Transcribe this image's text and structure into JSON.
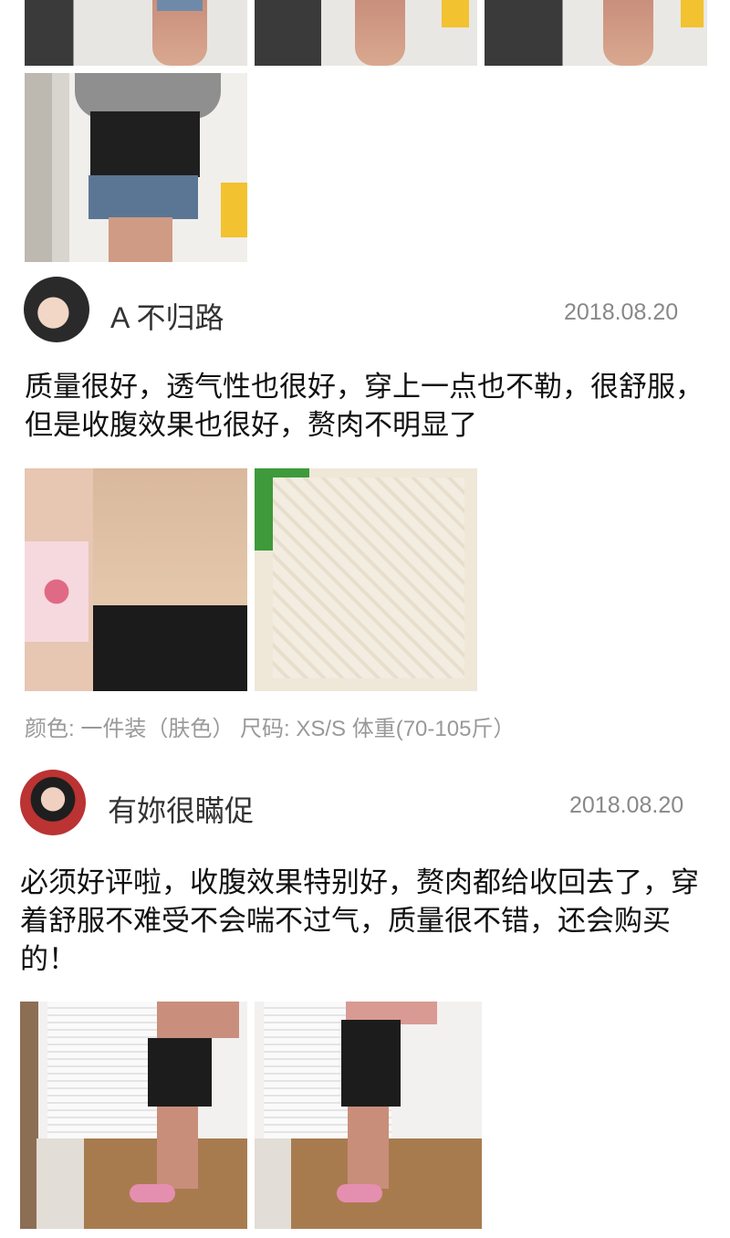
{
  "reviews": [
    {
      "username": "A 不归路",
      "date": "2018.08.20",
      "text": "质量很好，透气性也很好，穿上一点也不勒，很舒服，但是收腹效果也很好，赘肉不明显了",
      "sku_line": "颜色: 一件装（肤色） 尺码: XS/S 体重(70-105斤）"
    },
    {
      "username": "有妳很瞞促",
      "date": "2018.08.20",
      "text": "必须好评啦，收腹效果特别好，赘肉都给收回去了，穿着舒服不难受不会喘不过气，质量很不错，还会购买的！"
    }
  ]
}
